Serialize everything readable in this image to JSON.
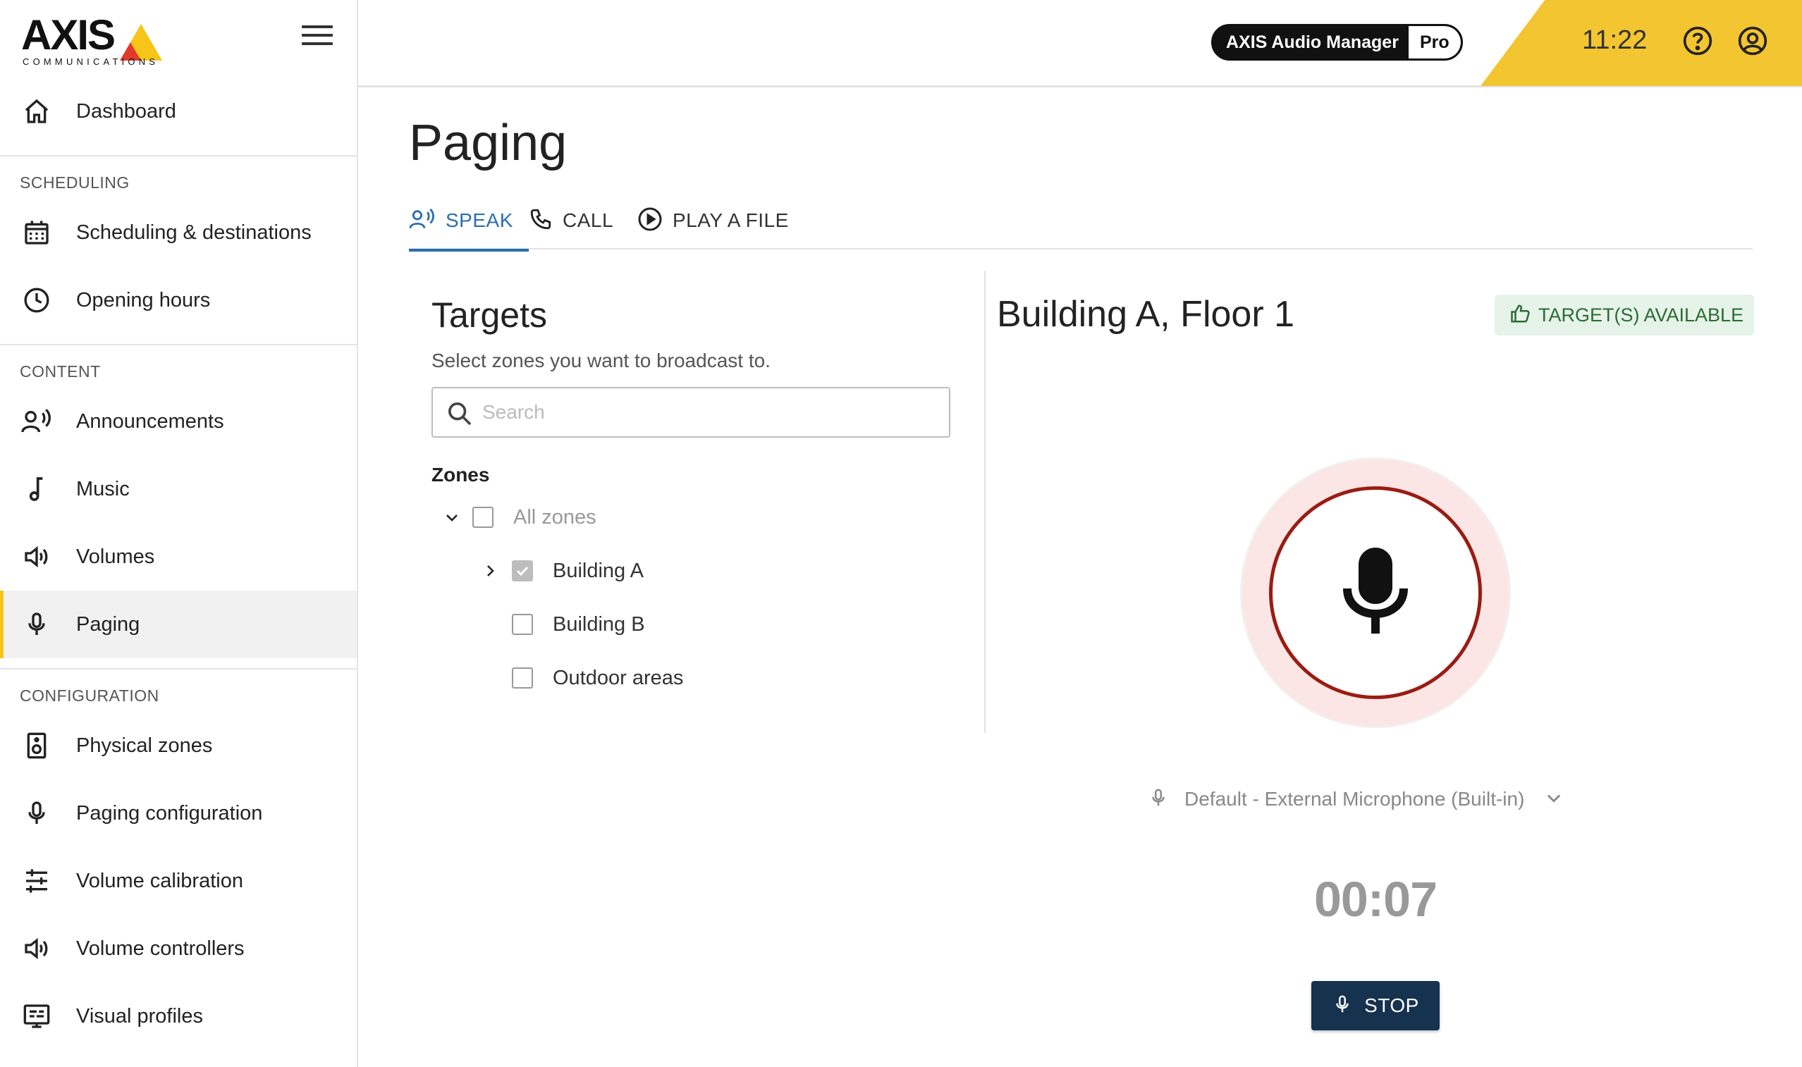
{
  "brand": {
    "name": "AXIS",
    "tagline": "COMMUNICATIONS"
  },
  "sidebar": {
    "top_item": {
      "label": "Dashboard",
      "icon": "home-icon"
    },
    "sections": [
      {
        "title": "SCHEDULING",
        "items": [
          {
            "label": "Scheduling & destinations",
            "icon": "calendar-icon"
          },
          {
            "label": "Opening hours",
            "icon": "clock-icon"
          }
        ]
      },
      {
        "title": "CONTENT",
        "items": [
          {
            "label": "Announcements",
            "icon": "speaking-person-icon"
          },
          {
            "label": "Music",
            "icon": "music-note-icon"
          },
          {
            "label": "Volumes",
            "icon": "speaker-icon"
          },
          {
            "label": "Paging",
            "icon": "microphone-icon",
            "active": true
          }
        ]
      },
      {
        "title": "CONFIGURATION",
        "items": [
          {
            "label": "Physical zones",
            "icon": "loudspeaker-icon"
          },
          {
            "label": "Paging configuration",
            "icon": "microphone-icon"
          },
          {
            "label": "Volume calibration",
            "icon": "sliders-icon"
          },
          {
            "label": "Volume controllers",
            "icon": "speaker-icon"
          },
          {
            "label": "Visual profiles",
            "icon": "display-icon"
          }
        ]
      }
    ]
  },
  "header": {
    "product_name": "AXIS Audio Manager",
    "product_tier": "Pro",
    "time": "11:22",
    "accent_color": "#f3c531"
  },
  "page": {
    "title": "Paging",
    "tabs": [
      {
        "label": "SPEAK",
        "icon": "speak-icon",
        "active": true
      },
      {
        "label": "CALL",
        "icon": "phone-icon"
      },
      {
        "label": "PLAY A FILE",
        "icon": "play-circle-icon"
      }
    ]
  },
  "targets": {
    "title": "Targets",
    "subtitle": "Select zones you want to broadcast to.",
    "search_placeholder": "Search",
    "zones_label": "Zones",
    "all_zones": {
      "label": "All zones",
      "checked": false,
      "expanded": true
    },
    "zones": [
      {
        "label": "Building A",
        "checked": true,
        "expandable": true
      },
      {
        "label": "Building B",
        "checked": false
      },
      {
        "label": "Outdoor areas",
        "checked": false
      }
    ]
  },
  "broadcast": {
    "area_title": "Building A, Floor 1",
    "status_badge": "TARGET(S) AVAILABLE",
    "status_color": "#2a6b35",
    "device": "Default - External Microphone (Built-in)",
    "timer": "00:07",
    "stop_label": "STOP",
    "recording_color": "#9a1c13"
  }
}
